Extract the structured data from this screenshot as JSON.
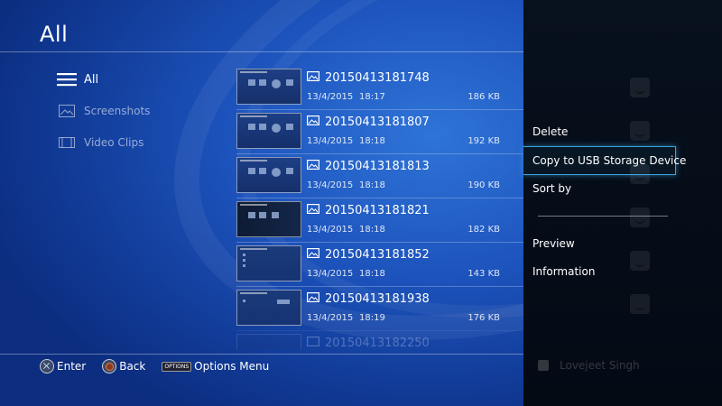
{
  "header": {
    "title": "All"
  },
  "nav": {
    "items": [
      {
        "label": "All",
        "icon": "hamburger-icon",
        "active": true
      },
      {
        "label": "Screenshots",
        "icon": "image-icon",
        "active": false
      },
      {
        "label": "Video Clips",
        "icon": "film-icon",
        "active": false
      }
    ]
  },
  "files": [
    {
      "name": "20150413181748",
      "date": "13/4/2015",
      "time": "18:17",
      "size": "186 KB"
    },
    {
      "name": "20150413181807",
      "date": "13/4/2015",
      "time": "18:18",
      "size": "192 KB"
    },
    {
      "name": "20150413181813",
      "date": "13/4/2015",
      "time": "18:18",
      "size": "190 KB"
    },
    {
      "name": "20150413181821",
      "date": "13/4/2015",
      "time": "18:18",
      "size": "182 KB"
    },
    {
      "name": "20150413181852",
      "date": "13/4/2015",
      "time": "18:18",
      "size": "143 KB"
    },
    {
      "name": "20150413181938",
      "date": "13/4/2015",
      "time": "18:19",
      "size": "176 KB"
    },
    {
      "name": "20150413182250",
      "date": "",
      "time": "",
      "size": ""
    }
  ],
  "footer": {
    "enter": "Enter",
    "back": "Back",
    "options_badge": "OPTIONS",
    "options": "Options Menu"
  },
  "options_menu": {
    "delete": "Delete",
    "copy_usb": "Copy to USB Storage Device",
    "sort_by": "Sort by",
    "preview": "Preview",
    "information": "Information",
    "selected": "Copy to USB Storage Device"
  },
  "user": {
    "name": "Lovejeet Singh"
  },
  "colors": {
    "accent": "#3aa4e0",
    "background": "#1c52bb",
    "panel": "#06101c"
  }
}
